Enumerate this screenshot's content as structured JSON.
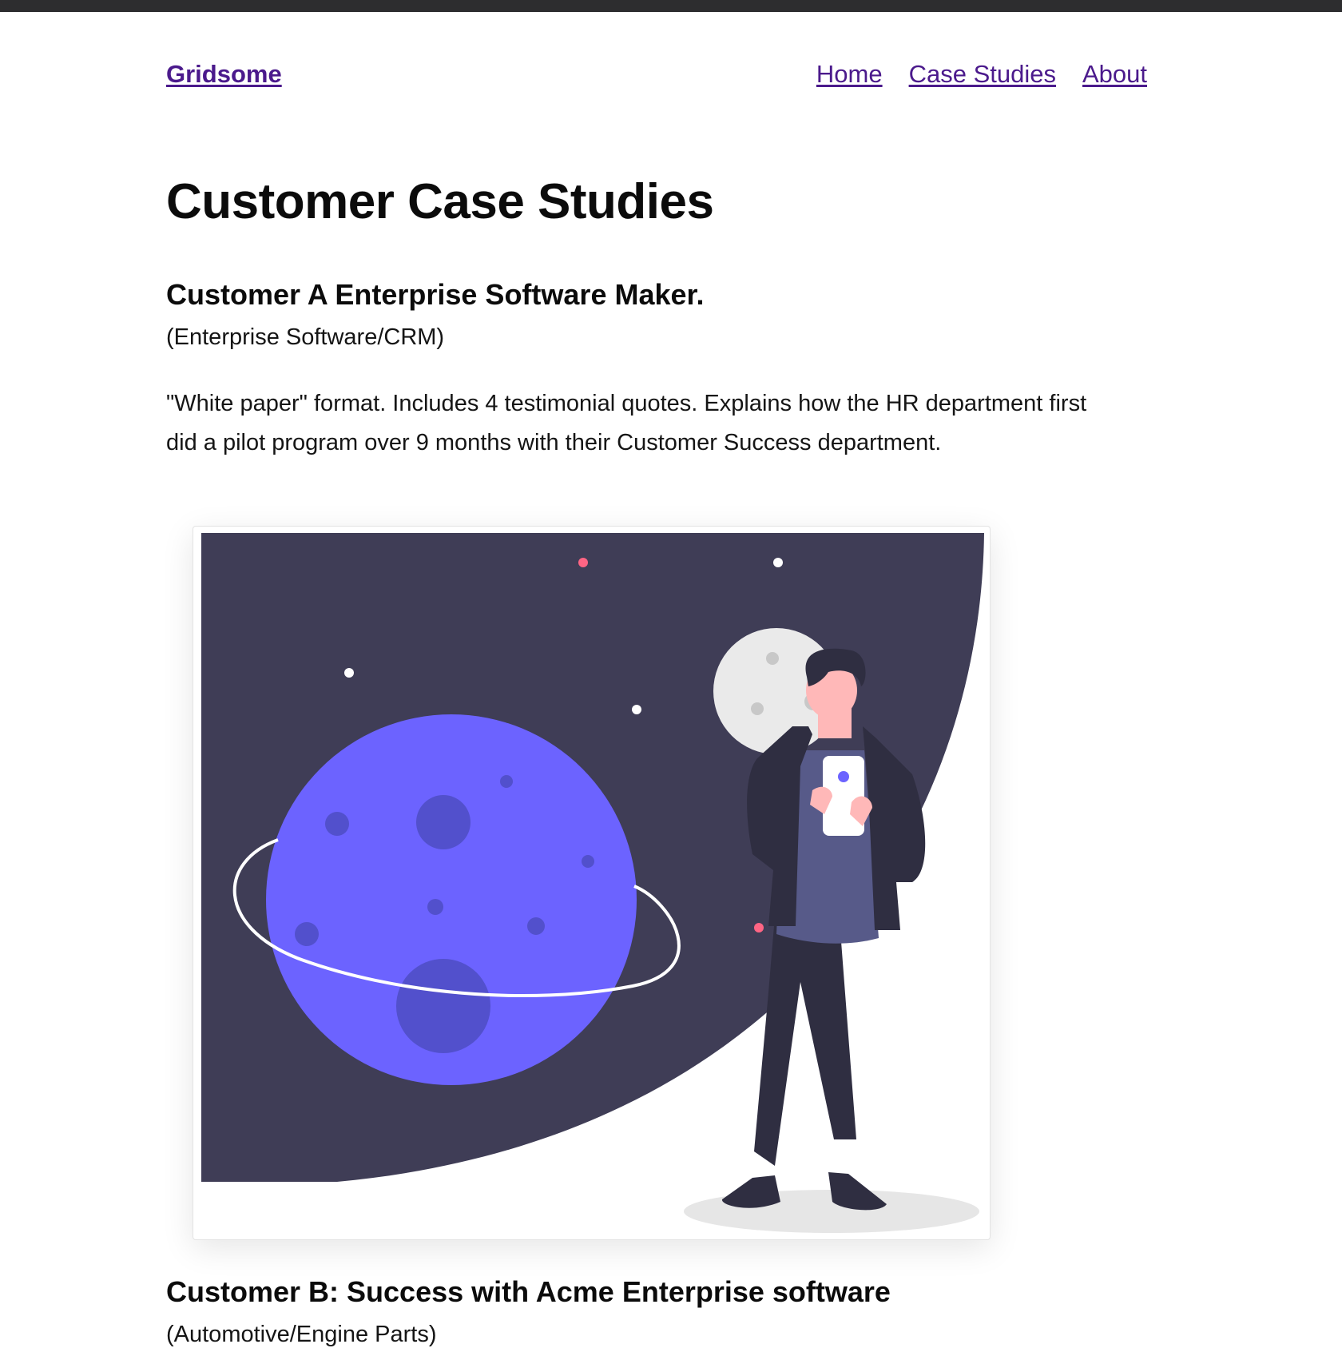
{
  "site": {
    "name": "Gridsome"
  },
  "nav": {
    "items": [
      {
        "label": "Home"
      },
      {
        "label": "Case Studies"
      },
      {
        "label": "About"
      }
    ]
  },
  "page": {
    "title": "Customer Case Studies"
  },
  "case_studies": [
    {
      "title": "Customer A Enterprise Software Maker.",
      "industry": "(Enterprise Software/CRM)",
      "description": "\"White paper\" format. Includes 4 testimonial quotes. Explains how the HR department first did a pilot program over 9 months with their Customer Success department.",
      "illustration": "space-planet-person-illustration"
    },
    {
      "title": "Customer B: Success with Acme Enterprise software",
      "industry": "(Automotive/Engine Parts)"
    }
  ],
  "colors": {
    "link": "#4b1a8c",
    "night_sky": "#3f3d56",
    "planet": "#6c63ff",
    "crater": "#5250cc",
    "moon": "#eaeaea",
    "accent_dot": "#ff6584"
  }
}
